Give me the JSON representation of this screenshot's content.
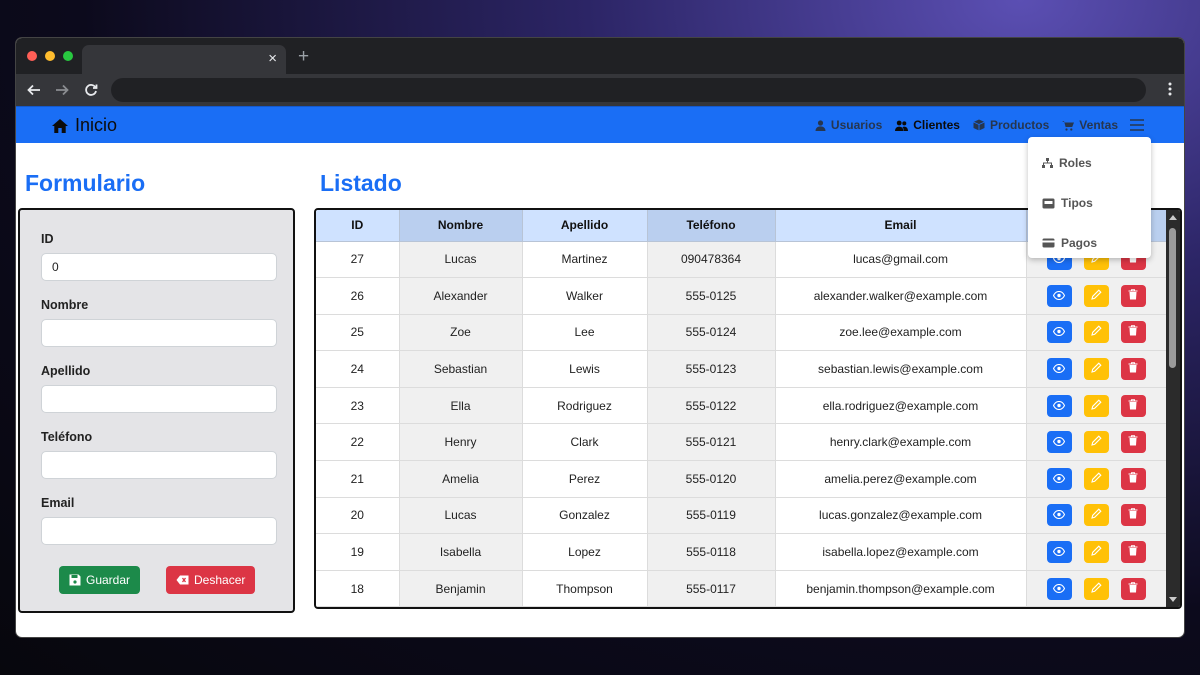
{
  "browser": {
    "tab_close": "×",
    "new_tab": "+"
  },
  "navbar": {
    "brand": "Inicio",
    "links": [
      {
        "label": "Usuarios",
        "icon": "user-icon"
      },
      {
        "label": "Clientes",
        "icon": "users-icon",
        "active": true
      },
      {
        "label": "Productos",
        "icon": "box-icon"
      },
      {
        "label": "Ventas",
        "icon": "cart-icon"
      }
    ],
    "menu_icon": "hamburger-icon"
  },
  "dropdown": {
    "items": [
      {
        "label": "Roles",
        "icon": "hierarchy-icon"
      },
      {
        "label": "Tipos",
        "icon": "inbox-icon"
      },
      {
        "label": "Pagos",
        "icon": "credit-card-icon"
      }
    ]
  },
  "form": {
    "title": "Formulario",
    "fields": [
      {
        "label": "ID",
        "value": "0"
      },
      {
        "label": "Nombre",
        "value": ""
      },
      {
        "label": "Apellido",
        "value": ""
      },
      {
        "label": "Teléfono",
        "value": ""
      },
      {
        "label": "Email",
        "value": ""
      }
    ],
    "save_label": "Guardar",
    "undo_label": "Deshacer"
  },
  "list": {
    "title": "Listado",
    "columns": [
      "ID",
      "Nombre",
      "Apellido",
      "Teléfono",
      "Email",
      ""
    ],
    "rows": [
      [
        "27",
        "Lucas",
        "Martinez",
        "090478364",
        "lucas@gmail.com"
      ],
      [
        "26",
        "Alexander",
        "Walker",
        "555-0125",
        "alexander.walker@example.com"
      ],
      [
        "25",
        "Zoe",
        "Lee",
        "555-0124",
        "zoe.lee@example.com"
      ],
      [
        "24",
        "Sebastian",
        "Lewis",
        "555-0123",
        "sebastian.lewis@example.com"
      ],
      [
        "23",
        "Ella",
        "Rodriguez",
        "555-0122",
        "ella.rodriguez@example.com"
      ],
      [
        "22",
        "Henry",
        "Clark",
        "555-0121",
        "henry.clark@example.com"
      ],
      [
        "21",
        "Amelia",
        "Perez",
        "555-0120",
        "amelia.perez@example.com"
      ],
      [
        "20",
        "Lucas",
        "Gonzalez",
        "555-0119",
        "lucas.gonzalez@example.com"
      ],
      [
        "19",
        "Isabella",
        "Lopez",
        "555-0118",
        "isabella.lopez@example.com"
      ],
      [
        "18",
        "Benjamin",
        "Thompson",
        "555-0117",
        "benjamin.thompson@example.com"
      ]
    ]
  },
  "colors": {
    "primary": "#1a6ef5",
    "success": "#1c8a4a",
    "danger": "#dc3545",
    "warning": "#ffc107"
  }
}
